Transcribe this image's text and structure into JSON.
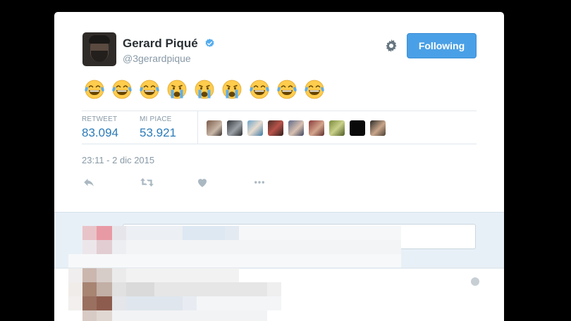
{
  "tweet": {
    "author_name": "Gerard Piqué",
    "author_handle": "@3gerardpique",
    "follow_label": "Following",
    "emojis": [
      "laughing-tears",
      "laughing-tears",
      "laughing-tears",
      "crying",
      "crying",
      "crying",
      "laughing-tears",
      "laughing-tears",
      "laughing-tears"
    ],
    "stats": {
      "retweets_label": "RETWEET",
      "retweets_value": "83.094",
      "likes_label": "MI PIACE",
      "likes_value": "53.921"
    },
    "timestamp": "23:11 - 2 dic 2015"
  },
  "colors": {
    "accent": "#4aa0e6",
    "link": "#2b7bb9",
    "muted": "#8899a6",
    "verified": "#55acee"
  },
  "icons": [
    "verified-icon",
    "gear-icon",
    "reply-icon",
    "retweet-icon",
    "like-icon",
    "more-icon",
    "globe-icon"
  ]
}
